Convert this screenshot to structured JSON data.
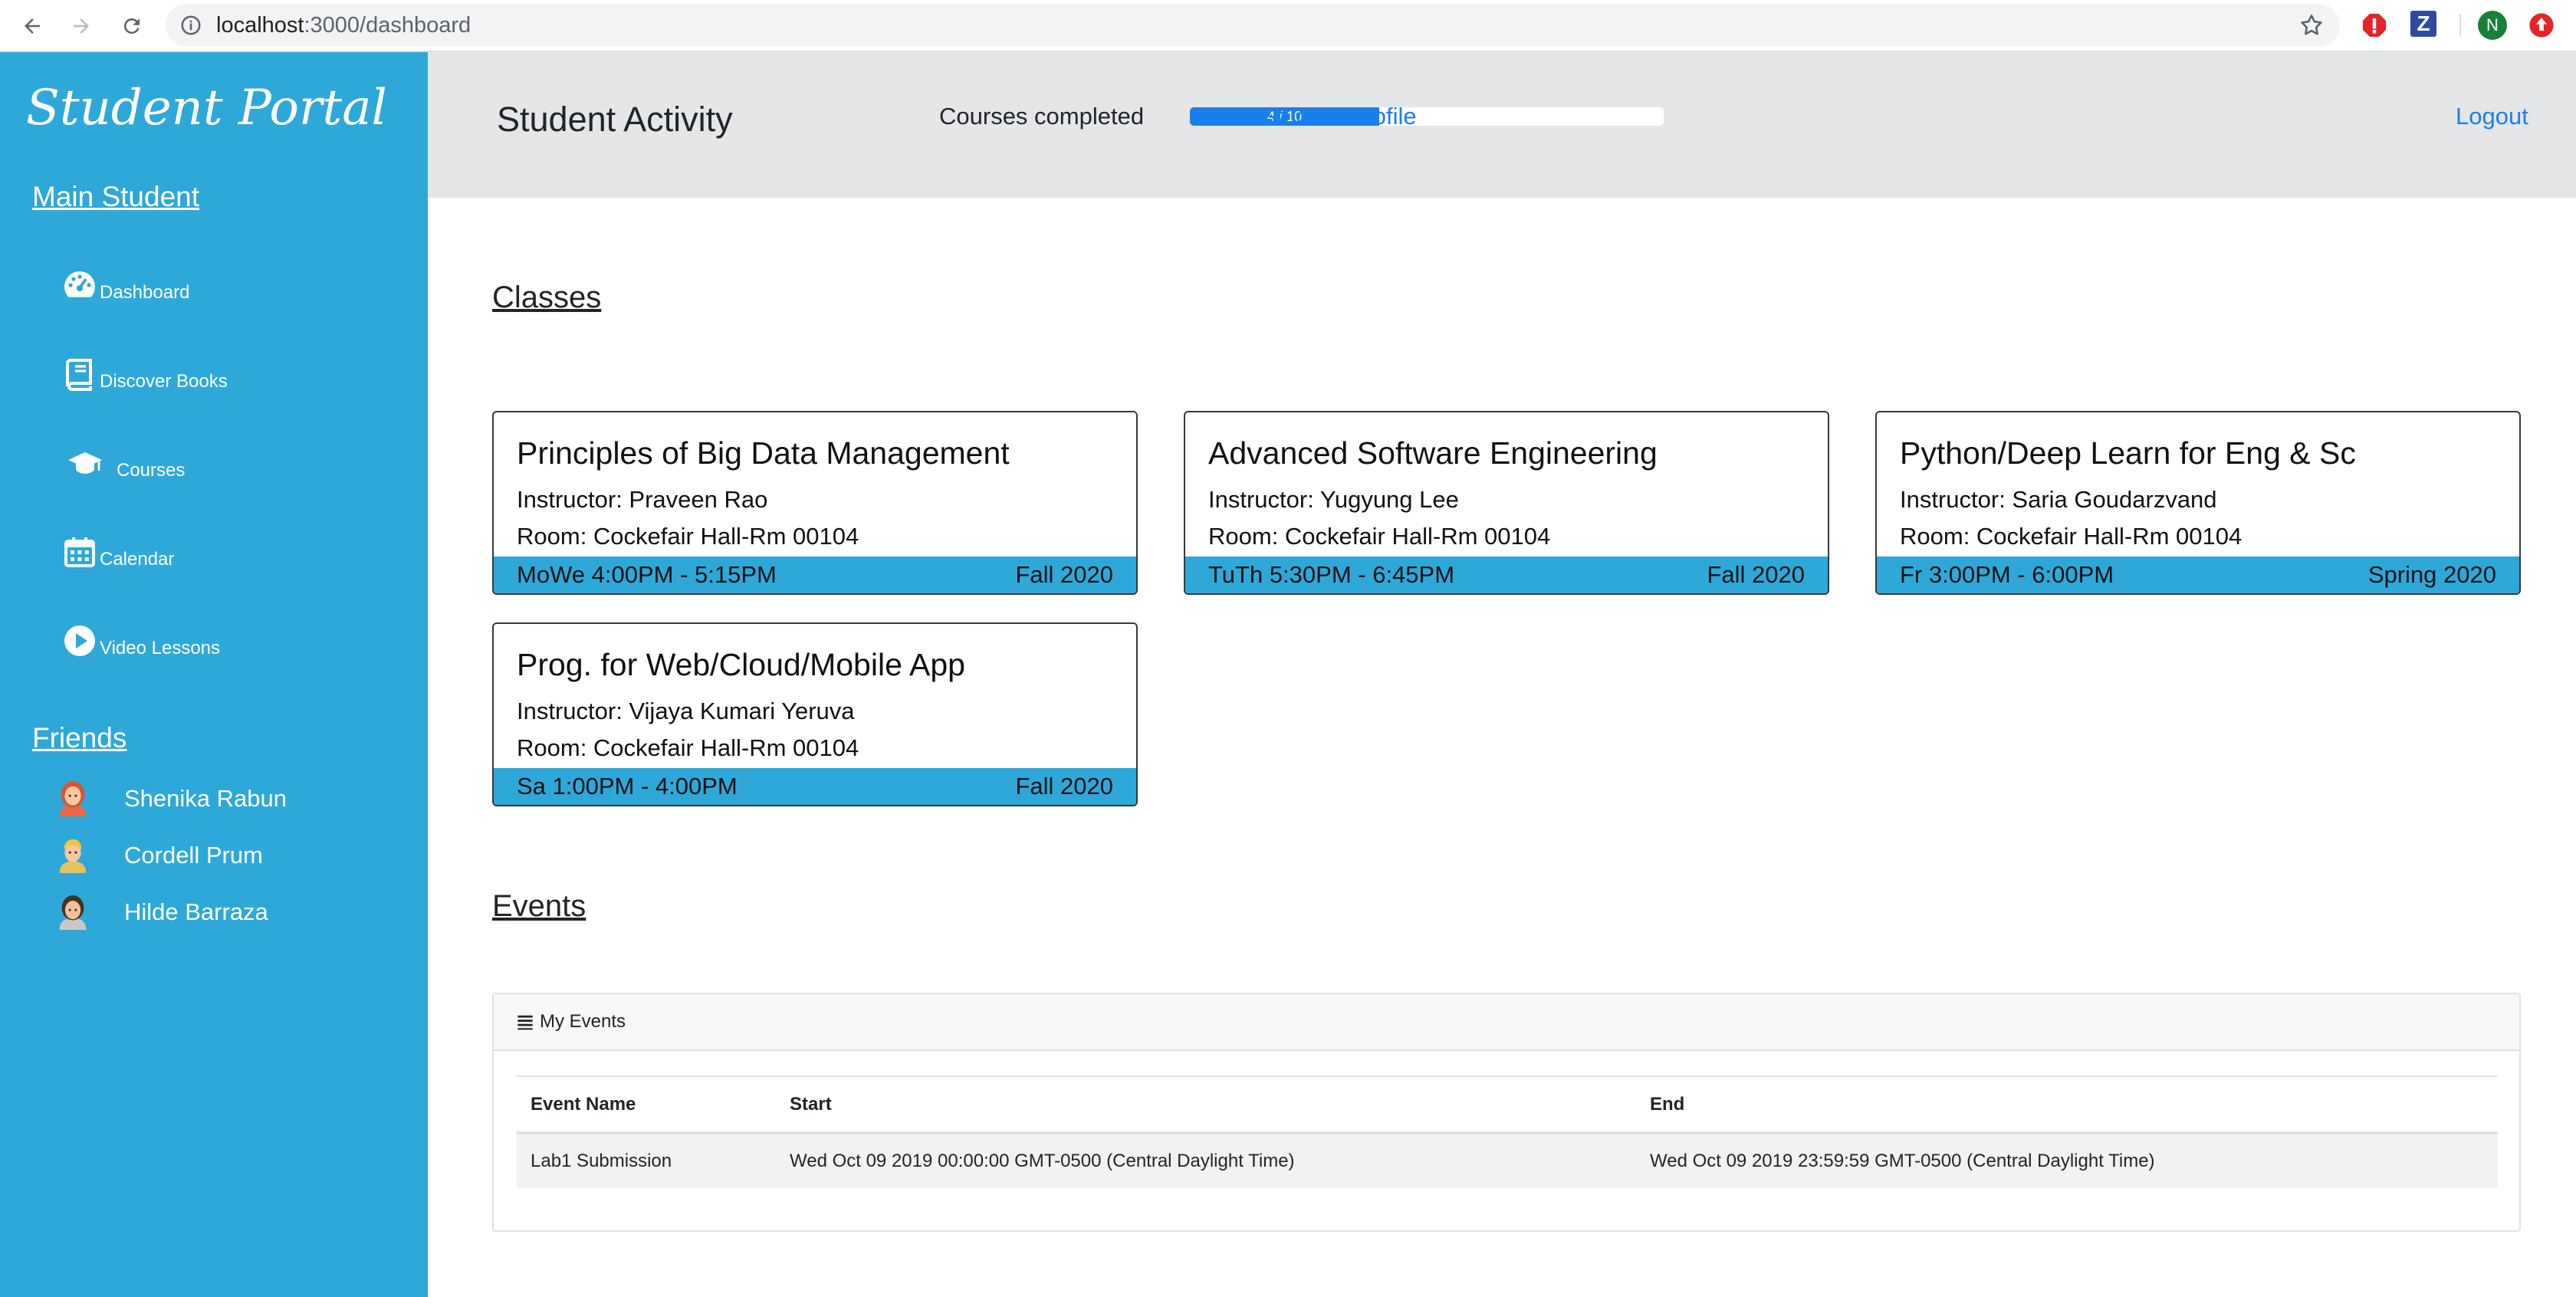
{
  "browser": {
    "url_host": "localhost",
    "url_rest": ":3000/dashboard",
    "avatar_initial": "N",
    "z_label": "Z"
  },
  "sidebar": {
    "brand": "Student Portal",
    "main_link": "Main Student",
    "nav": [
      {
        "label": "Dashboard",
        "icon": "dashboard-icon"
      },
      {
        "label": "Discover Books",
        "icon": "book-icon"
      },
      {
        "label": "Courses",
        "icon": "graduation-cap-icon"
      },
      {
        "label": "Calendar",
        "icon": "calendar-icon"
      },
      {
        "label": "Video Lessons",
        "icon": "play-circle-icon"
      }
    ],
    "friends_heading": "Friends",
    "friends": [
      {
        "name": "Shenika Rabun"
      },
      {
        "name": "Cordell Prum"
      },
      {
        "name": "Hilde Barraza"
      }
    ]
  },
  "header": {
    "title": "Student Activity",
    "progress_label": "Courses completed",
    "progress_text": "4 / 10",
    "progress_fraction": 0.4,
    "profile_link": "View Student Profile",
    "logout_link": "Logout"
  },
  "classes": {
    "heading": "Classes",
    "items": [
      {
        "title": "Principles of Big Data Management",
        "instructor": "Instructor: Praveen Rao",
        "room": "Room: Cockefair Hall-Rm 00104",
        "schedule": "MoWe 4:00PM - 5:15PM",
        "term": "Fall 2020"
      },
      {
        "title": "Advanced Software Engineering",
        "instructor": "Instructor: Yugyung Lee",
        "room": "Room: Cockefair Hall-Rm 00104",
        "schedule": "TuTh 5:30PM - 6:45PM",
        "term": "Fall 2020"
      },
      {
        "title": "Python/Deep Learn for Eng & Sc",
        "instructor": "Instructor: Saria Goudarzvand",
        "room": "Room: Cockefair Hall-Rm 00104",
        "schedule": "Fr 3:00PM - 6:00PM",
        "term": "Spring 2020"
      },
      {
        "title": "Prog. for Web/Cloud/Mobile App",
        "instructor": "Instructor: Vijaya Kumari Yeruva",
        "room": "Room: Cockefair Hall-Rm 00104",
        "schedule": "Sa 1:00PM - 4:00PM",
        "term": "Fall 2020"
      }
    ]
  },
  "events": {
    "heading": "Events",
    "panel_title": "My Events",
    "columns": [
      "Event Name",
      "Start",
      "End"
    ],
    "rows": [
      [
        "Lab1 Submission",
        "Wed Oct 09 2019 00:00:00 GMT-0500 (Central Daylight Time)",
        "Wed Oct 09 2019 23:59:59 GMT-0500 (Central Daylight Time)"
      ]
    ]
  },
  "colors": {
    "sidebar": "#2ea8d9",
    "accent_link": "#1a7fed",
    "progress_fill": "#1a7fed",
    "header_bg": "#e5e6e8"
  }
}
